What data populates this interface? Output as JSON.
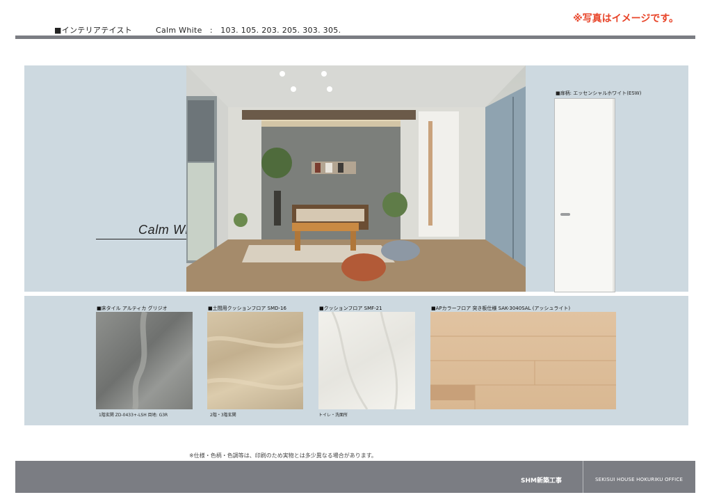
{
  "header": {
    "title": "■インテリアテイスト　　　Calm White　:　103. 105. 203. 205. 303. 305.",
    "note": "※写真はイメージです。"
  },
  "hero": {
    "caption": "Calm White"
  },
  "door": {
    "label": "■扉柄: エッセンシャルホワイト(ESW)"
  },
  "samples": [
    {
      "label": "■床タイル アルティカ グリジオ",
      "sub": "1階玄関 ZD-0433+-LSH 目地: G3R"
    },
    {
      "label": "■土間用クッションフロア SMD-16",
      "sub": "2階・3階玄関"
    },
    {
      "label": "■クッションフロア SMF-21",
      "sub": "トイレ・洗面所"
    },
    {
      "label": "■APカラーフロア 突き板仕様 SAK-3040SAL (アッシュライト)",
      "sub": ""
    }
  ],
  "disclaimer": "※仕様・色柄・色調等は、印刷のため実物とは多少異なる場合があります。",
  "footer": {
    "center": "SHM新築工事",
    "right": "SEKISUI HOUSE HOKURIKU OFFICE"
  },
  "colors": {
    "accent": "#e8452a",
    "panel": "#cdd9e0",
    "bar": "#7b7d83"
  }
}
